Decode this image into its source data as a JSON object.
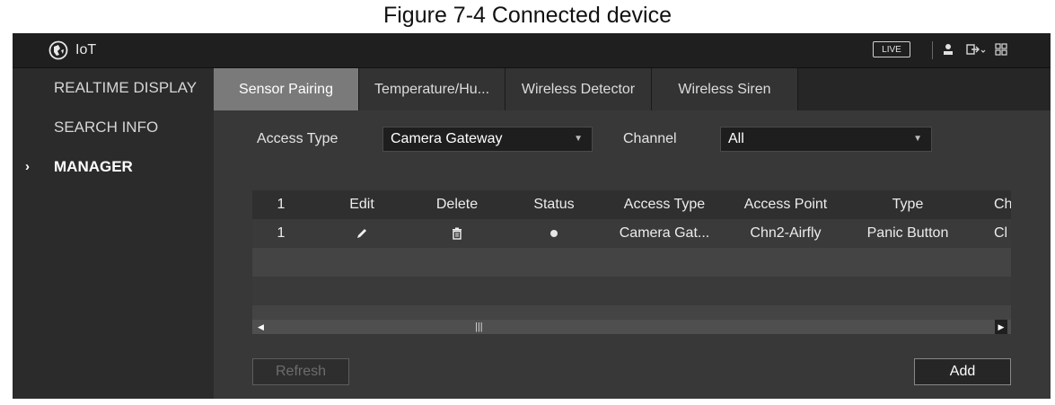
{
  "caption": "Figure 7-4 Connected device",
  "titlebar": {
    "title": "IoT",
    "live_label": "LIVE"
  },
  "sidebar": {
    "items": [
      {
        "label": "REALTIME DISPLAY"
      },
      {
        "label": "SEARCH INFO"
      },
      {
        "label": "MANAGER",
        "marker": "›",
        "active": true
      }
    ]
  },
  "tabs": [
    {
      "label": "Sensor Pairing",
      "active": true
    },
    {
      "label": "Temperature/Hu..."
    },
    {
      "label": "Wireless Detector"
    },
    {
      "label": "Wireless Siren"
    }
  ],
  "filters": {
    "access_type_label": "Access Type",
    "access_type_value": "Camera Gateway",
    "channel_label": "Channel",
    "channel_value": "All"
  },
  "table": {
    "columns": [
      "1",
      "Edit",
      "Delete",
      "Status",
      "Access Type",
      "Access Point",
      "Type",
      "Ch"
    ],
    "rows": [
      {
        "index": "1",
        "edit_icon": "pencil-icon",
        "delete_icon": "trash-icon",
        "status_icon": "dot-icon",
        "access_type": "Camera Gat...",
        "access_point": "Chn2-Airfly",
        "type": "Panic Button",
        "channel": "Cl"
      }
    ]
  },
  "buttons": {
    "refresh": "Refresh",
    "add": "Add"
  },
  "colors": {
    "active_tab": "#7a7a7a",
    "background": "#2b2b2b"
  }
}
